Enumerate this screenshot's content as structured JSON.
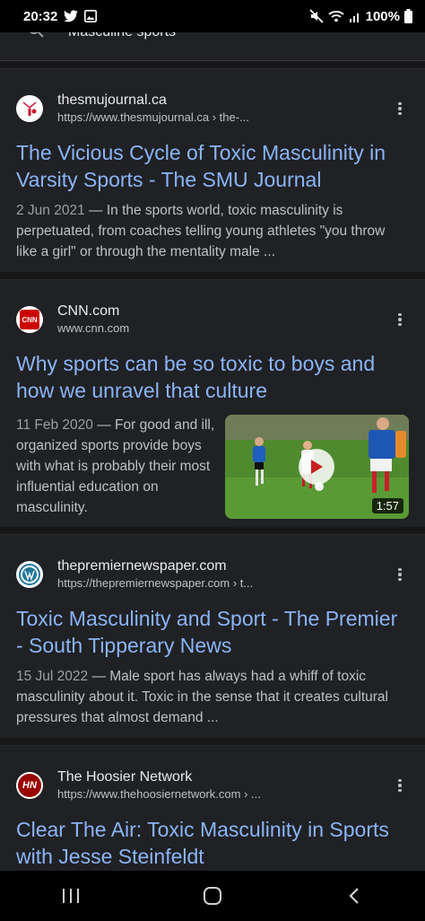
{
  "status": {
    "time": "20:32",
    "battery": "100%",
    "icons_left": [
      "twitter-icon",
      "image-icon"
    ],
    "icons_right": [
      "mute-icon",
      "wifi-icon",
      "signal-icon",
      "battery-icon"
    ]
  },
  "search": {
    "query": "Masculine sports"
  },
  "results": [
    {
      "site_name": "thesmujournal.ca",
      "url": "https://www.thesmujournal.ca › the-...",
      "title": "The Vicious Cycle of Toxic Masculinity in Varsity Sports - The SMU Journal",
      "date": "2 Jun 2021",
      "snippet": " — In the sports world, toxic masculinity is perpetuated, from coaches telling young athletes \"you throw like a girl\" or through the mentality male ..."
    },
    {
      "site_name": "CNN.com",
      "url": "www.cnn.com",
      "title": "Why sports can be so toxic to boys and how we unravel that culture",
      "date": "11 Feb 2020",
      "snippet": " — For good and ill, organized sports provide boys with what is probably their most influential education on masculinity.",
      "video_duration": "1:57",
      "favicon_text": "CNN"
    },
    {
      "site_name": "thepremiernewspaper.com",
      "url": "https://thepremiernewspaper.com › t...",
      "title": "Toxic Masculinity and Sport - The Premier - South Tipperary News",
      "date": "15 Jul 2022",
      "snippet": " — Male sport has always had a whiff of toxic masculinity about it. Toxic in the sense that it creates cultural pressures that almost demand ..."
    },
    {
      "site_name": "The Hoosier Network",
      "url": "https://www.thehoosiernetwork.com › ...",
      "title": "Clear The Air: Toxic Masculinity in Sports with Jesse Steinfeldt",
      "favicon_text": "HN"
    }
  ],
  "colors": {
    "link": "#8ab4f8",
    "card_bg": "#202124",
    "page_bg": "#171717"
  }
}
